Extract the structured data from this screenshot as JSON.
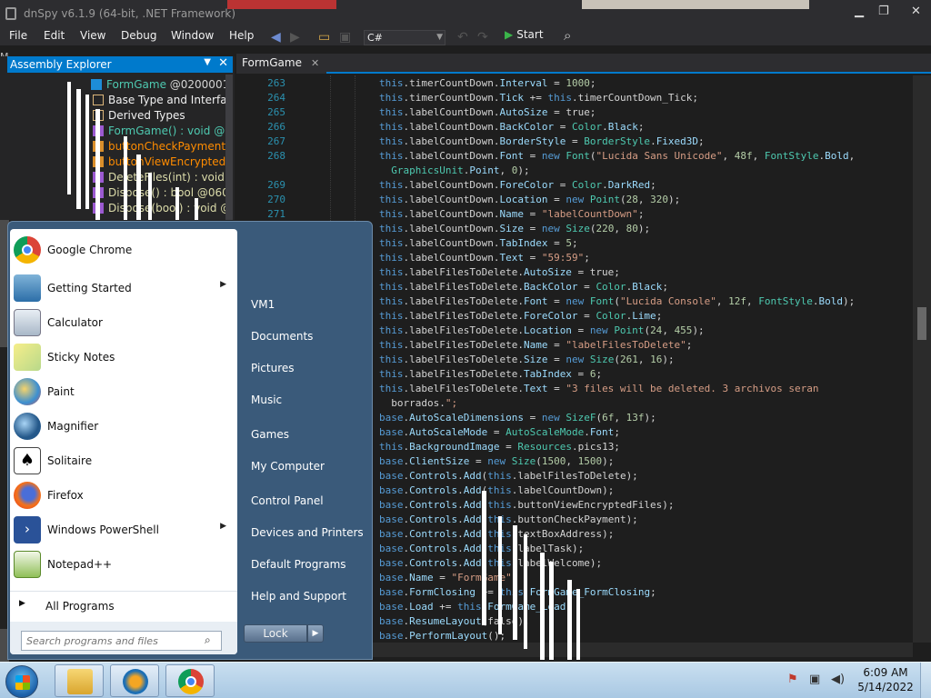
{
  "window": {
    "title": "dnSpy v6.1.9 (64-bit, .NET Framework)",
    "controls": {
      "minimize": "▁",
      "maximize": "❐",
      "close": "✕"
    }
  },
  "menu": [
    "File",
    "Edit",
    "View",
    "Debug",
    "Window",
    "Help"
  ],
  "toolbar": {
    "language": "C#",
    "start_label": "Start"
  },
  "side_letter": "M",
  "assembly_explorer": {
    "title": "Assembly Explorer",
    "nodes": [
      {
        "label": "FormGame",
        "suffix": " @02000011",
        "color": "#4ec9b0"
      },
      {
        "label": "Base Type and Interfac",
        "suffix": "",
        "color": "#f1f1f1"
      },
      {
        "label": "Derived Types",
        "suffix": "",
        "color": "#f1f1f1"
      },
      {
        "label": "FormGame() : void @0",
        "suffix": "",
        "color": "#4ec9b0"
      },
      {
        "label": "buttonCheckPayment",
        "suffix": "",
        "color": "#ff8c00"
      },
      {
        "label": "buttonViewEncryptedI",
        "suffix": "",
        "color": "#ff8c00"
      },
      {
        "label": "DeleteFiles(int) : void (",
        "suffix": "",
        "color": "#dcdcaa"
      },
      {
        "label": "Dispose() : bool @0600",
        "suffix": "",
        "color": "#dcdcaa"
      },
      {
        "label": "Dispose(bool) : void @",
        "suffix": "",
        "color": "#dcdcaa"
      }
    ]
  },
  "editor": {
    "tab": "FormGame",
    "tab_close": "✕",
    "line_numbers": [
      "263",
      "264",
      "265",
      "266",
      "267",
      "268",
      "",
      "269",
      "270",
      "271"
    ],
    "lines": [
      "this.timerCountDown.Interval = 1000;",
      "this.timerCountDown.Tick += this.timerCountDown_Tick;",
      "this.labelCountDown.AutoSize = true;",
      "this.labelCountDown.BackColor = Color.Black;",
      "this.labelCountDown.BorderStyle = BorderStyle.Fixed3D;",
      "this.labelCountDown.Font = new Font(\"Lucida Sans Unicode\", 48f, FontStyle.Bold,",
      "  GraphicsUnit.Point, 0);",
      "this.labelCountDown.ForeColor = Color.DarkRed;",
      "this.labelCountDown.Location = new Point(28, 320);",
      "this.labelCountDown.Name = \"labelCountDown\";",
      "this.labelCountDown.Size = new Size(220, 80);",
      "this.labelCountDown.TabIndex = 5;",
      "this.labelCountDown.Text = \"59:59\";",
      "this.labelFilesToDelete.AutoSize = true;",
      "this.labelFilesToDelete.BackColor = Color.Black;",
      "this.labelFilesToDelete.Font = new Font(\"Lucida Console\", 12f, FontStyle.Bold);",
      "this.labelFilesToDelete.ForeColor = Color.Lime;",
      "this.labelFilesToDelete.Location = new Point(24, 455);",
      "this.labelFilesToDelete.Name = \"labelFilesToDelete\";",
      "this.labelFilesToDelete.Size = new Size(261, 16);",
      "this.labelFilesToDelete.TabIndex = 6;",
      "this.labelFilesToDelete.Text = \"3 files will be deleted. 3 archivos seran",
      "  borrados.\";",
      "base.AutoScaleDimensions = new SizeF(6f, 13f);",
      "base.AutoScaleMode = AutoScaleMode.Font;",
      "this.BackgroundImage = Resources.pics13;",
      "base.ClientSize = new Size(1500, 1500);",
      "base.Controls.Add(this.labelFilesToDelete);",
      "base.Controls.Add(this.labelCountDown);",
      "base.Controls.Add(this.buttonViewEncryptedFiles);",
      "base.Controls.Add(this.buttonCheckPayment);",
      "base.Controls.Add(this.textBoxAddress);",
      "base.Controls.Add(this.labelTask);",
      "base.Controls.Add(this.labelWelcome);",
      "base.Name = \"FormGame\";",
      "base.FormClosing += this.FormGame_FormClosing;",
      "base.Load += this.FormGame_Load;",
      "base.ResumeLayout(false);",
      "base.PerformLayout();"
    ]
  },
  "start_menu": {
    "programs": [
      {
        "label": "Google Chrome",
        "icon": "chrome-icon",
        "submenu": false
      },
      {
        "label": "Getting Started",
        "icon": "getting-started-icon",
        "submenu": true
      },
      {
        "label": "Calculator",
        "icon": "calculator-icon",
        "submenu": false
      },
      {
        "label": "Sticky Notes",
        "icon": "sticky-notes-icon",
        "submenu": false
      },
      {
        "label": "Paint",
        "icon": "paint-icon",
        "submenu": false
      },
      {
        "label": "Magnifier",
        "icon": "magnifier-icon",
        "submenu": false
      },
      {
        "label": "Solitaire",
        "icon": "solitaire-icon",
        "submenu": false
      },
      {
        "label": "Firefox",
        "icon": "firefox-icon",
        "submenu": false
      },
      {
        "label": "Windows PowerShell",
        "icon": "powershell-icon",
        "submenu": true
      },
      {
        "label": "Notepad++",
        "icon": "notepadpp-icon",
        "submenu": false
      }
    ],
    "submenu_arrow": "▶",
    "all_programs": "All Programs",
    "search_placeholder": "Search programs and files",
    "right_items": [
      "VM1",
      "Documents",
      "Pictures",
      "Music",
      "Games",
      "My Computer",
      "Control Panel",
      "Devices and Printers",
      "Default Programs",
      "Help and Support"
    ],
    "lock_label": "Lock",
    "lock_arrow": "▶"
  },
  "taskbar": {
    "apps": [
      "explorer-icon",
      "media-player-icon",
      "chrome-icon"
    ],
    "time": "6:09 AM",
    "date": "5/14/2022"
  },
  "colors": {
    "accent": "#007acc",
    "editor_bg": "#1e1e1e",
    "keyword": "#569cd6",
    "field": "#9cdcfe",
    "type": "#4ec9b0",
    "string": "#d69d85",
    "number": "#b5cea8"
  }
}
